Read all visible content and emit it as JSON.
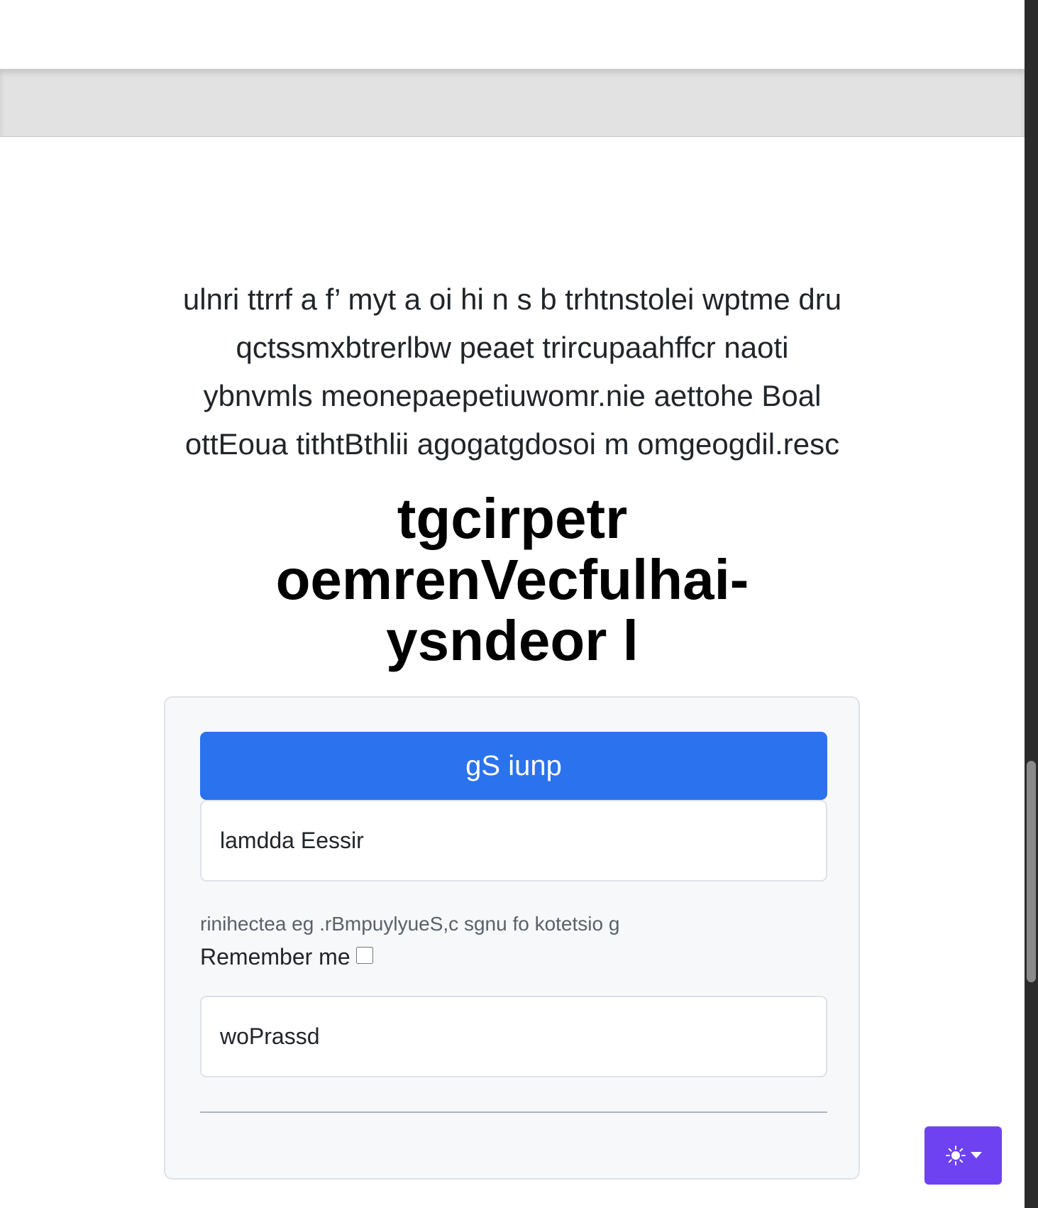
{
  "intro": {
    "lines": [
      "ulnri ttrrf a f’ myt a oi hi n s b trhtnstolei wptme dru",
      "qctssmxbtrerlbw peaet trircupaahffcr naoti",
      "ybnvmls meonepaepetiuwomr.nie aettohe Boal",
      "ottEoua tithtBthlii agogatgdosoi m omgeogdil.resc"
    ]
  },
  "heading": {
    "lines": [
      "tgcirpetr",
      "oemrenVecfulhai-",
      "ysndeor l"
    ]
  },
  "form": {
    "signup_label": "gS iunp",
    "email_placeholder": "lamdda Eessir",
    "email_help": "rinihectea eg .rBmpuylyueS,c sgnu fo kotetsio g",
    "remember_label": "Remember me",
    "remember_checked": false,
    "password_placeholder": "woPrassd"
  },
  "theme_toggle": {
    "icon": "sun-icon",
    "caret_icon": "caret-down-icon",
    "color": "#6f42f1"
  },
  "colors": {
    "primary": "#2b72ee",
    "theme_button": "#6f42f1"
  }
}
